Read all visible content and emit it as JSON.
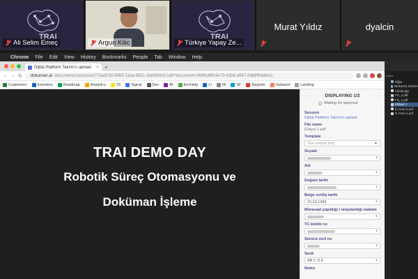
{
  "participants": [
    {
      "name": "Ali Selim Emeç",
      "type": "logo"
    },
    {
      "name": "Argun Kilic",
      "type": "video"
    },
    {
      "name": "Türkiye Yapay Ze...",
      "type": "logo"
    },
    {
      "name": "Murat Yıldız",
      "type": "name-only"
    },
    {
      "name": "dyalcin",
      "type": "name-only"
    }
  ],
  "menubar": {
    "app": "Chrome",
    "items": [
      "File",
      "Edit",
      "View",
      "History",
      "Bookmarks",
      "People",
      "Tab",
      "Window",
      "Help"
    ]
  },
  "browser": {
    "tab_title": "Dijital Platform Takımı's upload",
    "url_host": "dokuman.ai",
    "url_path": "/documents/sessions/77dad230-95b5-11ea-9821-3de080c5c1d0?document=3686c6f8-6e73-42b8-a967-0db8f6fa8e1c",
    "bookmarks": [
      {
        "label": "Customers",
        "color": "#2e7d32"
      },
      {
        "label": "Investors",
        "color": "#1565c0"
      },
      {
        "label": "Roadmap",
        "color": "#0f9d58"
      },
      {
        "label": "Analytics",
        "color": "#f4a300"
      },
      {
        "label": "JS",
        "color": "#f7df1e"
      },
      {
        "label": "Signal",
        "color": "#3a76f0"
      },
      {
        "label": "Dev",
        "color": "#555555"
      },
      {
        "label": "BI",
        "color": "#7b1fa2"
      },
      {
        "label": "EncHelp",
        "color": "#4caf50"
      },
      {
        "label": "LI",
        "color": "#0a66c2"
      },
      {
        "label": "IN",
        "color": "#888888"
      },
      {
        "label": "SF",
        "color": "#00a1e0"
      },
      {
        "label": "Reports",
        "color": "#e53935"
      },
      {
        "label": "Hubspot",
        "color": "#ff7a59"
      },
      {
        "label": "Landlog",
        "color": "#9e9e9e"
      }
    ]
  },
  "slide": {
    "title": "TRAI DEMO DAY",
    "line1": "Robotik Süreç Otomasyonu ve",
    "line2": "Doküman İşleme"
  },
  "panel": {
    "displaying": "DISPLAYING 1/2",
    "status": "Waiting for approval",
    "session_label": "Session",
    "session_value": "Dijital Platform Takımı's upload",
    "file_label": "File name",
    "file_value": "Ehliyet 1.pdf",
    "template_label": "Template",
    "template_value": "Yeni ehliyet (ön)",
    "fields": [
      {
        "label": "Soyadı",
        "value": "",
        "blur": 34
      },
      {
        "label": "Adı",
        "value": "",
        "blur": 22
      },
      {
        "label": "Doğum tarihi",
        "value": "",
        "blur": 42
      },
      {
        "label": "Belge veriliş tarihi",
        "value": "15.03.1996",
        "blur": 0
      },
      {
        "label": "Müracaat yapıldığı / onaylandığı makam",
        "value": "",
        "blur": 24
      },
      {
        "label": "TC kimlik no",
        "value": "",
        "blur": 40
      },
      {
        "label": "Sürücü sicil no",
        "value": "",
        "blur": 18
      },
      {
        "label": "Sınıfı",
        "value": "AB C D E",
        "blur": 0
      }
    ],
    "notes_label": "Notes"
  },
  "finder": {
    "sidebar_label": "Home",
    "files": [
      {
        "name": "Diğer",
        "kind": "folder",
        "selected": false
      },
      {
        "name": "Birleşmiş Doküm",
        "kind": "folder",
        "selected": false
      },
      {
        "name": "ruhsat.jpg",
        "kind": "doc",
        "selected": false
      },
      {
        "name": "Fis_2.pdf",
        "kind": "doc",
        "selected": false
      },
      {
        "name": "Fis_1.pdf",
        "kind": "doc",
        "selected": false
      },
      {
        "name": "Ehliyet 1",
        "kind": "doc",
        "selected": true
      },
      {
        "name": "E-Arsiv-2.pdf",
        "kind": "doc",
        "selected": false
      },
      {
        "name": "E-Arsiv-1.pdf",
        "kind": "doc",
        "selected": false
      }
    ]
  }
}
